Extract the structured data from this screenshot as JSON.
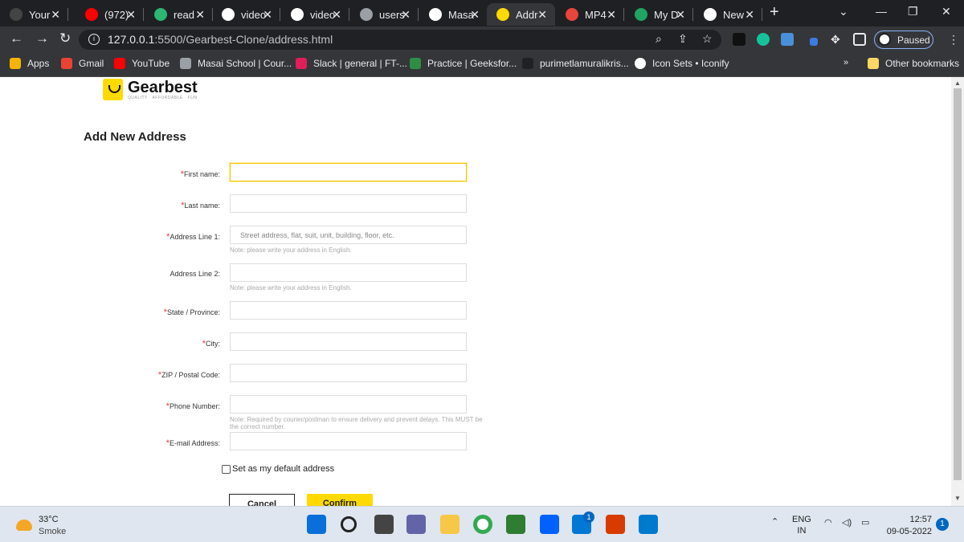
{
  "tabs": [
    {
      "title": "Your",
      "color": "#444"
    },
    {
      "title": "(972)",
      "color": "#ff0000"
    },
    {
      "title": "read",
      "color": "#2bb673"
    },
    {
      "title": "video",
      "color": "#ffffff"
    },
    {
      "title": "video",
      "color": "#ffffff"
    },
    {
      "title": "users",
      "color": "#9aa0a6"
    },
    {
      "title": "Masa",
      "color": "#ffffff"
    },
    {
      "title": "Addr",
      "color": "#ffda00"
    },
    {
      "title": "MP4",
      "color": "#e8453c"
    },
    {
      "title": "My D",
      "color": "#1fa463"
    },
    {
      "title": "New",
      "color": "#ffffff"
    }
  ],
  "browser": {
    "url_host": "127.0.0.1",
    "url_rest": ":5500/Gearbest-Clone/address.html",
    "profile_status": "Paused"
  },
  "bookmarks": [
    {
      "label": "Apps",
      "icon": "apps-grid-icon"
    },
    {
      "label": "Gmail",
      "icon": "gmail-icon"
    },
    {
      "label": "YouTube",
      "icon": "youtube-icon"
    },
    {
      "label": "Masai School | Cour...",
      "icon": "globe-icon"
    },
    {
      "label": "Slack | general | FT-...",
      "icon": "slack-icon"
    },
    {
      "label": "Practice | Geeksfor...",
      "icon": "geeksforgeeks-icon"
    },
    {
      "label": "purimetlamuralikris...",
      "icon": "globe-icon"
    },
    {
      "label": "Icon Sets • Iconify",
      "icon": "iconify-icon"
    }
  ],
  "other_bookmarks": "Other bookmarks",
  "logo": {
    "name": "Gearbest",
    "tagline": "QUALITY · AFFORDABLE · FUN"
  },
  "form": {
    "heading": "Add New Address",
    "fields": [
      {
        "label": "First name:",
        "required": true,
        "placeholder": "",
        "note": ""
      },
      {
        "label": "Last name:",
        "required": true,
        "placeholder": "",
        "note": ""
      },
      {
        "label": "Address Line 1:",
        "required": true,
        "placeholder": "Street address, flat, suit, unit, building, floor, etc.",
        "note": "Note: please write your address in English."
      },
      {
        "label": "Address Line 2:",
        "required": false,
        "placeholder": "",
        "note": "Note: please write your address in English."
      },
      {
        "label": "State / Province:",
        "required": true,
        "placeholder": "",
        "note": ""
      },
      {
        "label": "City:",
        "required": true,
        "placeholder": "",
        "note": ""
      },
      {
        "label": "ZIP / Postal Code:",
        "required": true,
        "placeholder": "",
        "note": ""
      },
      {
        "label": "Phone Number:",
        "required": true,
        "placeholder": "",
        "note": "Note: Required by courier/postman to ensure delivery and prevent delays. This MUST be the correct number."
      },
      {
        "label": "E-mail Address:",
        "required": true,
        "placeholder": "",
        "note": ""
      }
    ],
    "default_label": "Set as my default address",
    "cancel_label": "Cancel",
    "confirm_label": "Confirm"
  },
  "taskbar": {
    "temperature": "33°C",
    "weather": "Smoke",
    "lang1": "ENG",
    "lang2": "IN",
    "time": "12:57",
    "date": "09-05-2022",
    "notifications": "1",
    "mail_badge": "1"
  }
}
